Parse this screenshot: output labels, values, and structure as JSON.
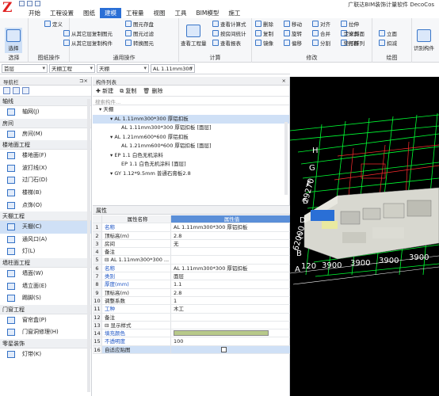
{
  "app": {
    "title": "广联达BIM装饰计量软件 DecoCos"
  },
  "menu": [
    "开始",
    "工程设置",
    "图纸",
    "建模",
    "工程量",
    "视图",
    "工具",
    "BIM模型",
    "施工"
  ],
  "ribbon": {
    "select": {
      "label": "选择",
      "group": "选择"
    },
    "drawing_ops": {
      "items": [
        "定义",
        "从其它层复制图元",
        "从其它层复制构件"
      ],
      "group": "图纸操作"
    },
    "general": {
      "items": [
        "图元存盘",
        "图元过滤",
        "转换图元"
      ],
      "group": "通用操作"
    },
    "calc": {
      "items": [
        "查看工程量",
        "查看计算式",
        "按房间统计",
        "查看报表"
      ],
      "group": "计算"
    },
    "modify": {
      "items": [
        "删除",
        "复制",
        "镜像",
        "移动",
        "旋转",
        "偏移",
        "对齐",
        "合并",
        "分割",
        "拉伸",
        "修剪",
        "打断"
      ],
      "group": "修改"
    },
    "draw": {
      "items": [
        "定义斜面",
        "矩形阵列",
        "立面",
        "扣减"
      ],
      "group": "绘图"
    },
    "identify": {
      "label": "识别构件"
    }
  },
  "toolbar2": {
    "floor": "首层",
    "type": "天棚工程",
    "sub": "天棚",
    "component": "AL 1.11mm300"
  },
  "nav": {
    "title": "导航栏",
    "categories": [
      {
        "name": "轴线",
        "items": [
          {
            "label": "轴网(J)"
          }
        ]
      },
      {
        "name": "房间",
        "items": [
          {
            "label": "房间(M)"
          }
        ]
      },
      {
        "name": "楼地面工程",
        "items": [
          {
            "label": "楼地面(F)"
          },
          {
            "label": "波打线(X)"
          },
          {
            "label": "过门石(D)"
          },
          {
            "label": "楼梯(B)"
          },
          {
            "label": "点饰(O)"
          }
        ]
      },
      {
        "name": "天棚工程",
        "items": [
          {
            "label": "天棚(C)",
            "active": true
          },
          {
            "label": "通风口(A)"
          },
          {
            "label": "灯(L)"
          }
        ]
      },
      {
        "name": "墙柱面工程",
        "items": [
          {
            "label": "墙面(W)"
          },
          {
            "label": "墙立面(E)"
          },
          {
            "label": "踢脚(S)"
          }
        ]
      },
      {
        "name": "门窗工程",
        "items": [
          {
            "label": "窗帘盒(P)"
          },
          {
            "label": "门窗洞修理(H)"
          }
        ]
      },
      {
        "name": "零星装饰",
        "items": [
          {
            "label": "灯带(K)"
          }
        ]
      }
    ]
  },
  "comp": {
    "title": "构件列表",
    "tools": [
      "新建",
      "复制",
      "删除"
    ],
    "search": "搜索构件...",
    "tree": [
      {
        "t": "▾ 天棚",
        "lvl": 0
      },
      {
        "t": "▾ AL 1.11mm300*300 厚铝扣板",
        "lvl": 1,
        "hl": true
      },
      {
        "t": "AL 1.11mm300*300 厚铝扣板 [面层]",
        "lvl": 2
      },
      {
        "t": "▾ AL 1.21mm600*600 厚铝扣板",
        "lvl": 1
      },
      {
        "t": "AL 1.21mm600*600 厚铝扣板 [面层]",
        "lvl": 2
      },
      {
        "t": "▾ EP 1.1 白色无机涂料",
        "lvl": 1
      },
      {
        "t": "EP 1.1 白色无机涂料 [面层]",
        "lvl": 2
      },
      {
        "t": "▾ GY 1.12*9.5mm 普通石膏板2.8",
        "lvl": 1
      }
    ]
  },
  "props": {
    "title": "属性",
    "headers": [
      "属性名称",
      "属性值"
    ],
    "rows": [
      {
        "n": "1",
        "k": "名称",
        "v": "AL 1.11mm300*300 厚铝扣板",
        "kb": true
      },
      {
        "n": "2",
        "k": "顶标高(m)",
        "v": "2.8"
      },
      {
        "n": "3",
        "k": "房间",
        "v": "无"
      },
      {
        "n": "4",
        "k": "备注",
        "v": ""
      },
      {
        "n": "5",
        "k": "⊟ AL 1.11mm300*300 ...",
        "v": ""
      },
      {
        "n": "6",
        "k": "    名称",
        "v": "AL 1.11mm300*300 厚铝扣板",
        "kb": true
      },
      {
        "n": "7",
        "k": "    类别",
        "v": "面层",
        "kb": true
      },
      {
        "n": "8",
        "k": "    厚度(mm)",
        "v": "1.1",
        "kb": true
      },
      {
        "n": "9",
        "k": "    顶标高(m)",
        "v": "2.8"
      },
      {
        "n": "10",
        "k": "    调整系数",
        "v": "1"
      },
      {
        "n": "11",
        "k": "    工种",
        "v": "木工",
        "kb": true
      },
      {
        "n": "12",
        "k": "    备注",
        "v": ""
      },
      {
        "n": "13",
        "k": "⊟ 显示样式",
        "v": ""
      },
      {
        "n": "14",
        "k": "    填充颜色",
        "v": "",
        "fill": true,
        "kb": true
      },
      {
        "n": "15",
        "k": "    不透明度",
        "v": "100",
        "kb": true
      },
      {
        "n": "16",
        "k": "自适应贴图",
        "v": "",
        "check": true
      }
    ]
  },
  "viewport": {
    "labels": [
      "H",
      "G",
      "F",
      "E",
      "D",
      "C",
      "B",
      "A"
    ],
    "dims": [
      "29270",
      "62000",
      "3900",
      "3900",
      "3900",
      "3900",
      "120"
    ]
  },
  "colors": {
    "accent": "#2a6fd6",
    "grid": "#00ff33",
    "axis": "#ffffff",
    "fill": "#b8c98a"
  }
}
